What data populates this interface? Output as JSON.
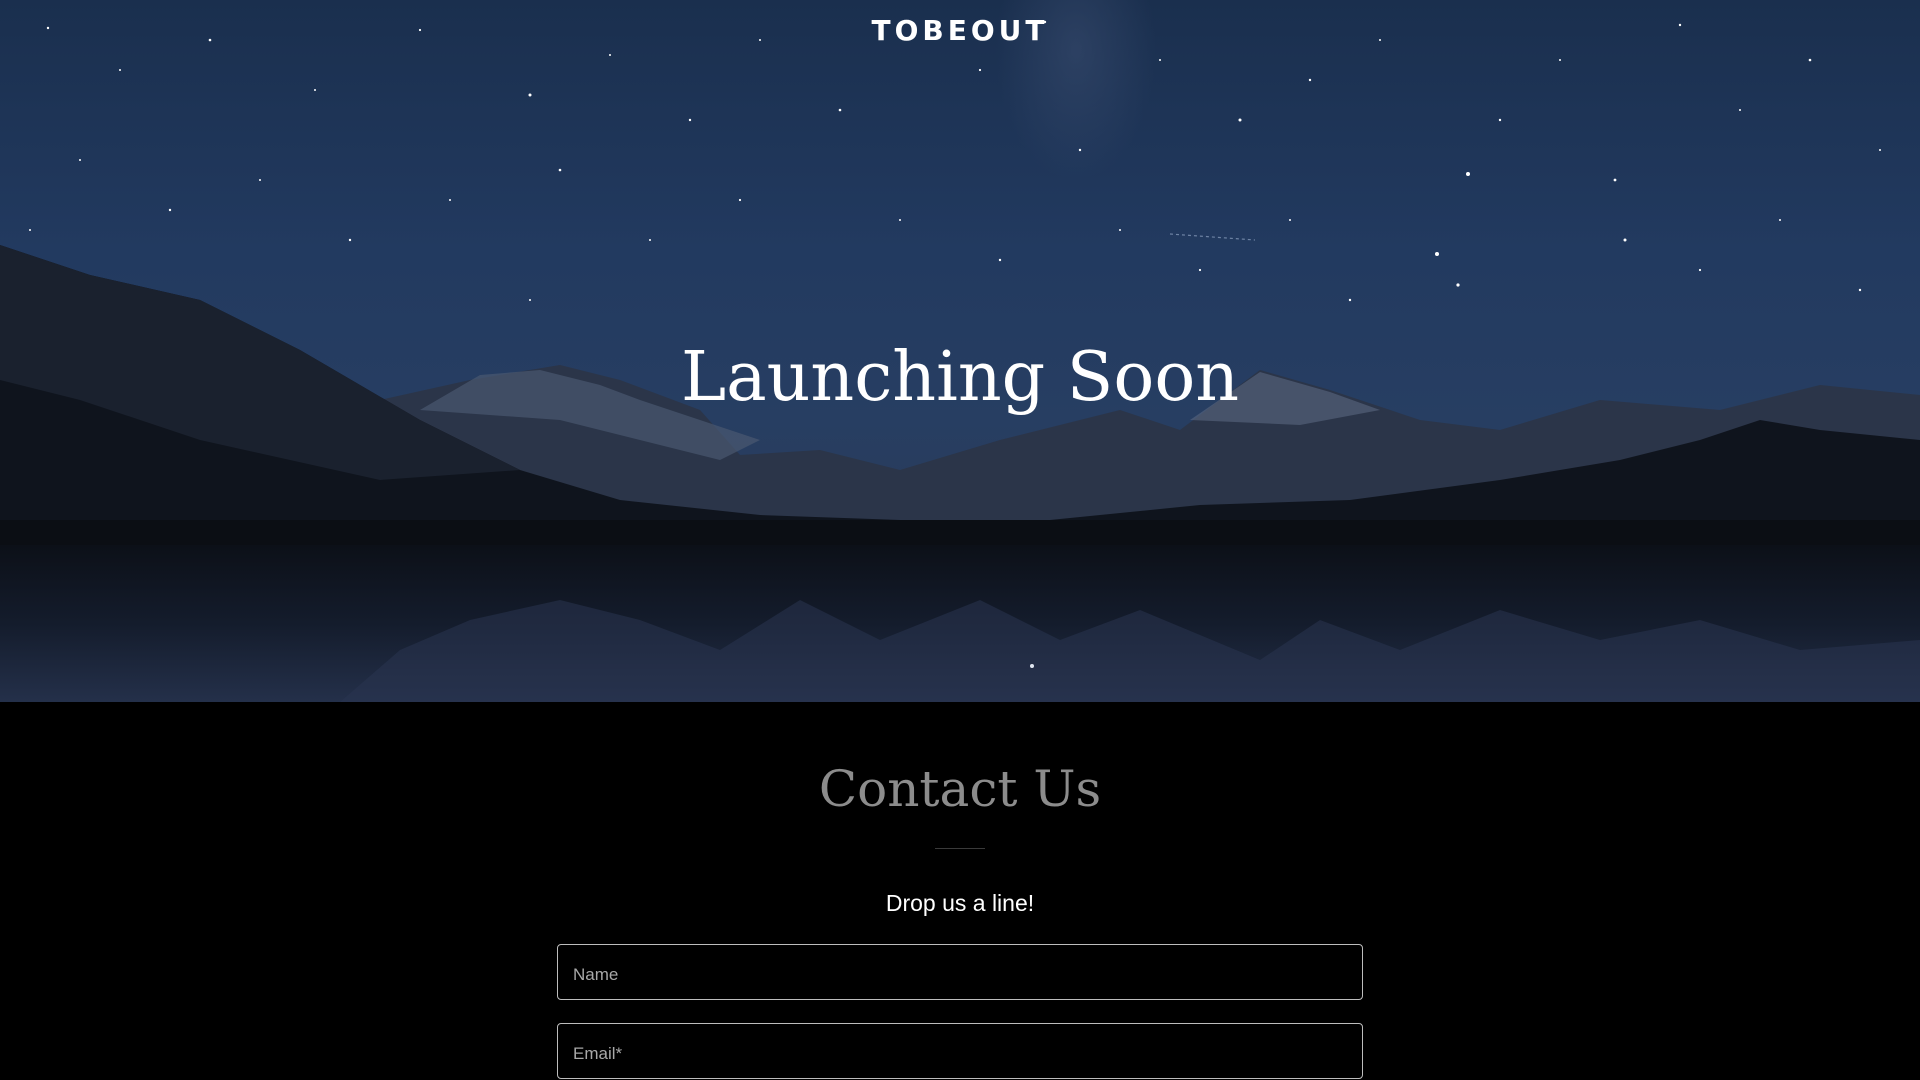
{
  "header": {
    "brand": "TOBEOUT"
  },
  "hero": {
    "title": "Launching Soon",
    "background_icon": "night-mountain-lake-photo"
  },
  "contact": {
    "title": "Contact Us",
    "tagline": "Drop us a line!",
    "fields": {
      "name_placeholder": "Name",
      "email_placeholder": "Email*"
    }
  },
  "colors": {
    "sky": "#1f3a60",
    "mountain": "#0d1118",
    "water": "#1a2438",
    "section_bg": "#000000",
    "contact_title": "#8c8c8c",
    "field_border": "#bdbdbd"
  }
}
